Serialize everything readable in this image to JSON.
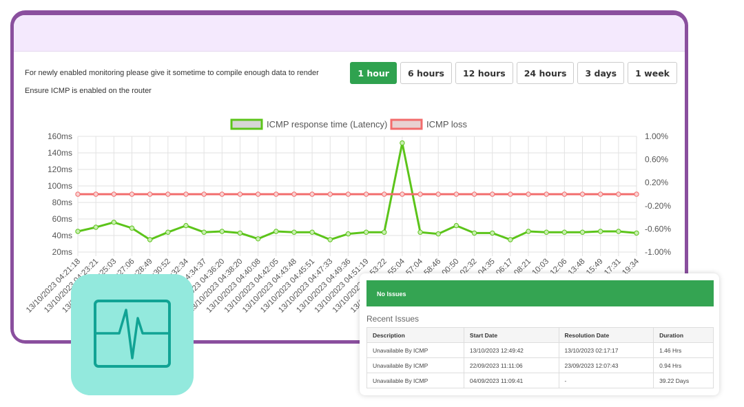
{
  "info": {
    "line1": "For newly enabled monitoring please give it sometime to compile enough data to render",
    "line2": "Ensure ICMP is enabled on the router"
  },
  "ranges": [
    {
      "label": "1 hour",
      "active": true
    },
    {
      "label": "6 hours",
      "active": false
    },
    {
      "label": "12 hours",
      "active": false
    },
    {
      "label": "24 hours",
      "active": false
    },
    {
      "label": "3 days",
      "active": false
    },
    {
      "label": "1 week",
      "active": false
    }
  ],
  "chart_data": {
    "type": "line",
    "legend_position": "top",
    "grid": true,
    "y_left": {
      "ticks": [
        "20ms",
        "40ms",
        "60ms",
        "80ms",
        "100ms",
        "120ms",
        "140ms",
        "160ms"
      ],
      "range": [
        20,
        160
      ],
      "unit": "ms"
    },
    "y_right": {
      "ticks": [
        "-1.00%",
        "-0.60%",
        "-0.20%",
        "0.20%",
        "0.60%",
        "1.00%"
      ],
      "range": [
        -1,
        1
      ],
      "unit": "%"
    },
    "x": [
      "13/10/2023 04:21:18",
      "13/10/2023 04:23:21",
      "13/10/2023 04:25:03",
      "13/10/2023 04:27:06",
      "13/10/2023 04:28:49",
      "13/10/2023 04:30:52",
      "13/10/2023 04:32:34",
      "13/10/2023 04:34:37",
      "13/10/2023 04:36:20",
      "13/10/2023 04:38:20",
      "13/10/2023 04:40:08",
      "13/10/2023 04:42:05",
      "13/10/2023 04:43:48",
      "13/10/2023 04:45:51",
      "13/10/2023 04:47:33",
      "13/10/2023 04:49:36",
      "13/10/2023 04:51:19",
      "13/10/2023 04:53:22",
      "13/10/2023 04:55:04",
      "13/10/2023 04:57:04",
      "13/10/2023 04:58:46",
      "13/10/2023 05:00:50",
      "13/10/2023 05:02:32",
      "13/10/2023 05:04:35",
      "13/10/2023 05:06:17",
      "13/10/2023 05:08:21",
      "13/10/2023 05:10:03",
      "13/10/2023 05:12:06",
      "13/10/2023 05:13:48",
      "13/10/2023 05:15:49",
      "13/10/2023 05:17:31",
      "13/10/2023 05:19:34"
    ],
    "series": [
      {
        "name": "ICMP response time (Latency)",
        "axis": "left",
        "color": "#5cc41a",
        "values": [
          45,
          50,
          56,
          49,
          35,
          44,
          52,
          44,
          45,
          43,
          36,
          45,
          44,
          44,
          35,
          42,
          44,
          44,
          152,
          44,
          42,
          52,
          43,
          43,
          35,
          45,
          44,
          44,
          44,
          45,
          45,
          43
        ]
      },
      {
        "name": "ICMP loss",
        "axis": "right",
        "color": "#f26c6c",
        "values": [
          0,
          0,
          0,
          0,
          0,
          0,
          0,
          0,
          0,
          0,
          0,
          0,
          0,
          0,
          0,
          0,
          0,
          0,
          0,
          0,
          0,
          0,
          0,
          0,
          0,
          0,
          0,
          0,
          0,
          0,
          0,
          0
        ]
      }
    ]
  },
  "status": {
    "label": "No Issues",
    "color": "#34a452"
  },
  "recent": {
    "title": "Recent Issues",
    "columns": [
      "Description",
      "Start Date",
      "Resolution Date",
      "Duration"
    ],
    "rows": [
      [
        "Unavailable By ICMP",
        "13/10/2023 12:49:42",
        "13/10/2023 02:17:17",
        "1.46 Hrs"
      ],
      [
        "Unavailable By ICMP",
        "22/09/2023 11:11:06",
        "23/09/2023 12:07:43",
        "0.94 Hrs"
      ],
      [
        "Unavailable By ICMP",
        "04/09/2023 11:09:41",
        "-",
        "39.22 Days"
      ]
    ]
  },
  "icon": "heartbeat-monitor-icon"
}
